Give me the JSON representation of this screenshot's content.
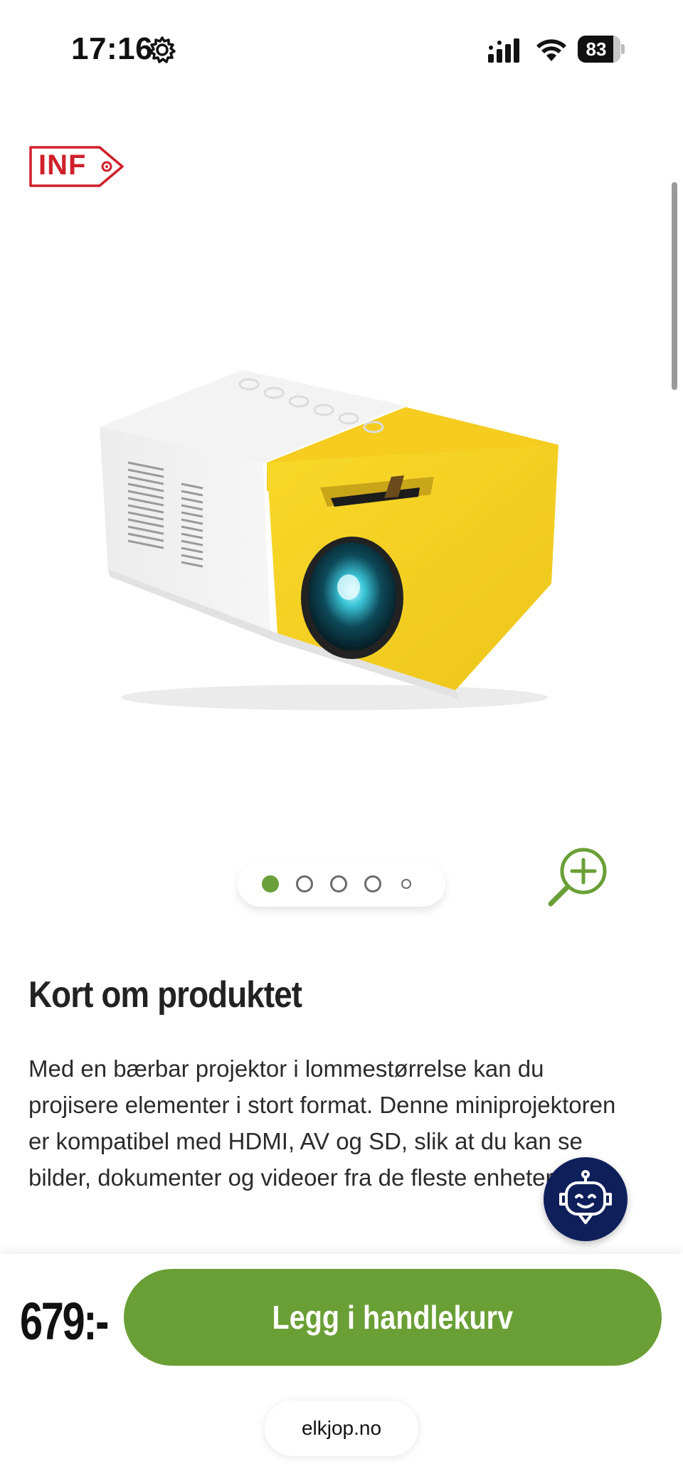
{
  "status_bar": {
    "time": "17:16",
    "battery": "83",
    "icons": [
      "gear-icon",
      "signal-icon",
      "wifi-icon",
      "battery-icon"
    ]
  },
  "badge": {
    "label": "INF"
  },
  "product": {
    "image_icon": "projector-image",
    "carousel": {
      "count": 5,
      "active_index": 0
    }
  },
  "summary": {
    "title": "Kort om produktet",
    "text": "Med en bærbar projektor i lommestørrelse kan du projisere elementer i stort format. Denne miniprojektoren er kompatibel med HDMI, AV og SD, slik at du kan se bilder, dokumenter og videoer fra de fleste enheter."
  },
  "purchase": {
    "price": "679:-",
    "add_to_cart_label": "Legg i handlekurv"
  },
  "browser": {
    "url": "elkjop.no"
  },
  "colors": {
    "accent_green": "#6a9f35",
    "badge_red": "#d0202b",
    "chatbot_navy": "#0f1f5a"
  }
}
